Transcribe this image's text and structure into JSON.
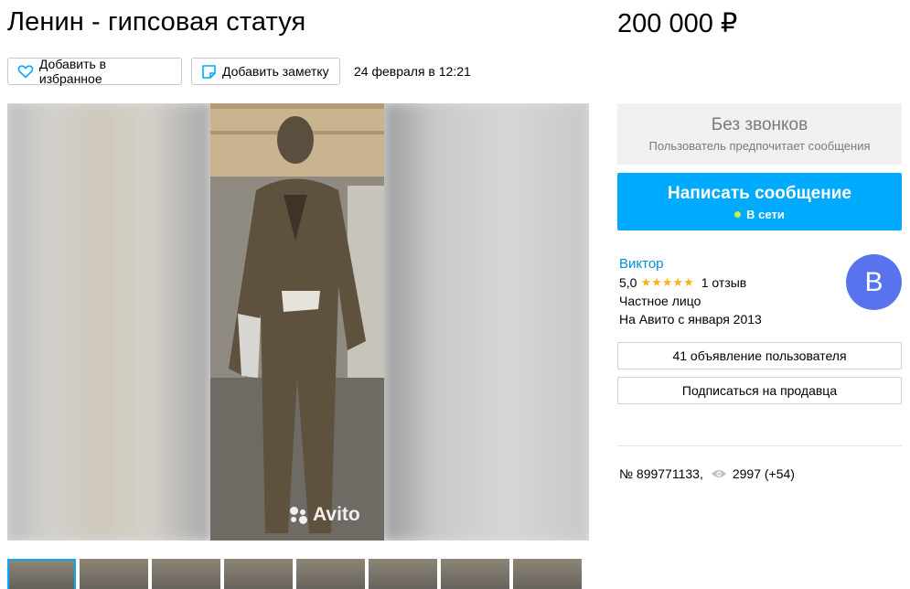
{
  "listing": {
    "title": "Ленин - гипсовая статуя",
    "price": "200 000 ₽",
    "date": "24 февраля в 12:21",
    "number": "№ 899771133,",
    "views": "2997 (+54)"
  },
  "actions": {
    "favorite_label": "Добавить в избранное",
    "note_label": "Добавить заметку"
  },
  "contact": {
    "no_calls_title": "Без звонков",
    "no_calls_subtitle": "Пользователь предпочитает сообщения",
    "message_button": "Написать сообщение",
    "online_status": "В сети"
  },
  "seller": {
    "name": "Виктор",
    "rating": "5,0",
    "stars": "★★★★★",
    "reviews": "1 отзыв",
    "type": "Частное лицо",
    "since": "На Авито с января 2013",
    "avatar_letter": "В",
    "ads_button": "41 объявление пользователя",
    "subscribe_button": "Подписаться на продавца"
  },
  "gallery": {
    "watermark": "Avito",
    "thumbnail_count": 8
  },
  "colors": {
    "accent": "#00aaff",
    "link": "#0091d9",
    "star": "#ffb021",
    "avatar": "#5973ef",
    "online": "#c4f04f"
  },
  "icons": [
    "heart-icon",
    "note-icon",
    "eye-icon",
    "avito-logo-icon"
  ]
}
